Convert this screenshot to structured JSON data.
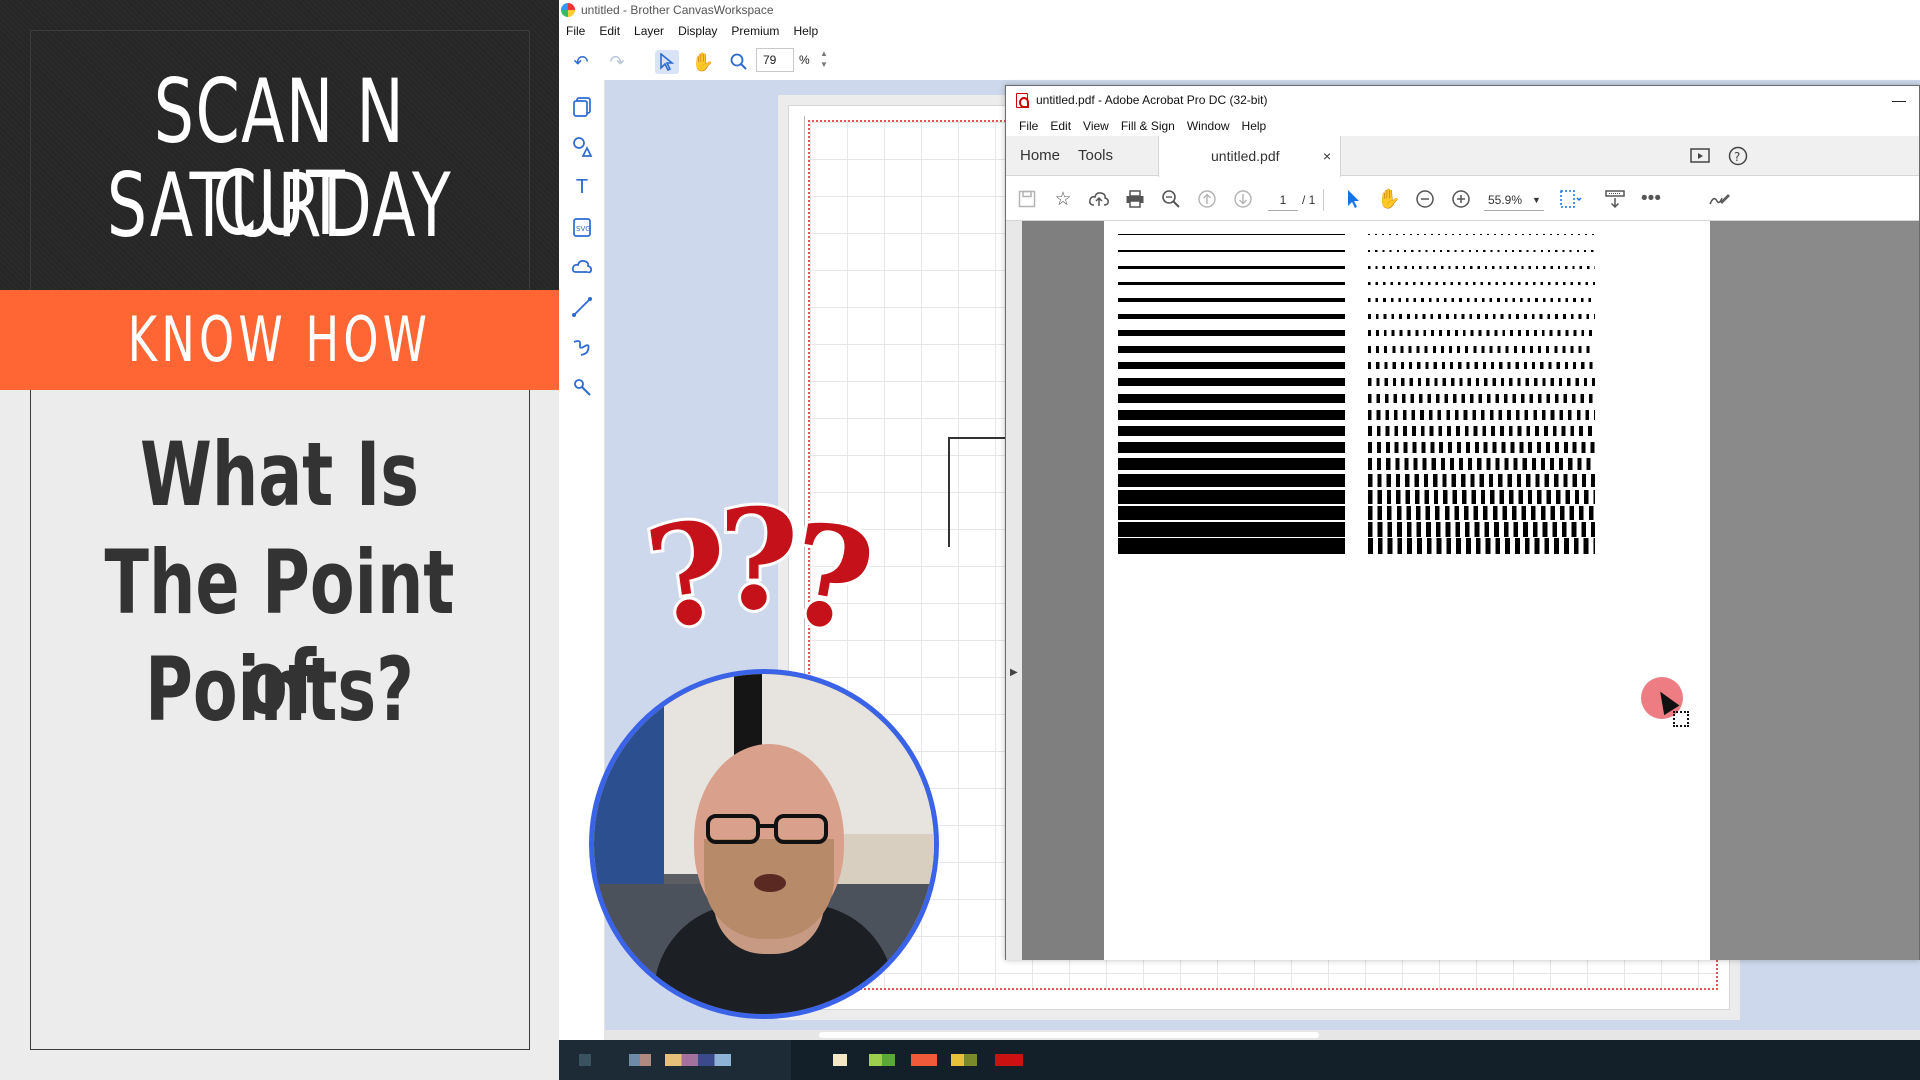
{
  "promo": {
    "title_line1": "SCAN N CUT",
    "title_line2": "SATURDAY",
    "band": "KNOW HOW",
    "heading_line1": "What Is",
    "heading_line2": "The Point of",
    "heading_line3": "Points?"
  },
  "canvasworkspace": {
    "window_title": "untitled - Brother CanvasWorkspace",
    "menu": [
      "File",
      "Edit",
      "Layer",
      "Display",
      "Premium",
      "Help"
    ],
    "zoom_value": "79",
    "zoom_unit": "%",
    "toolbar_icons": [
      "undo-icon",
      "redo-icon",
      "select-icon",
      "hand-icon",
      "zoom-icon"
    ],
    "side_icons": [
      "object-icon",
      "shapes-icon",
      "text-icon",
      "svg-icon",
      "cloud-icon",
      "line-icon",
      "freehand-icon",
      "pen-icon"
    ],
    "accent_color": "#2c6bcf",
    "canvas_bg": "#cdd8ec"
  },
  "acrobat": {
    "window_title": "untitled.pdf - Adobe Acrobat Pro DC (32-bit)",
    "menu": [
      "File",
      "Edit",
      "View",
      "Fill & Sign",
      "Window",
      "Help"
    ],
    "tab_home": "Home",
    "tab_tools": "Tools",
    "doc_tab": "untitled.pdf",
    "doc_tab_close": "×",
    "page_current": "1",
    "page_total": "/ 1",
    "zoom": "55.9%"
  },
  "document": {
    "solid_line_count": 20,
    "dotted_line_count": 20,
    "line_color": "#000000"
  },
  "overlay": {
    "question_marks": [
      "?",
      "?",
      "?"
    ],
    "question_color": "#c5121a",
    "webcam_ring_color": "#3b63e8",
    "cursor_halo_color": "#e8505a"
  }
}
